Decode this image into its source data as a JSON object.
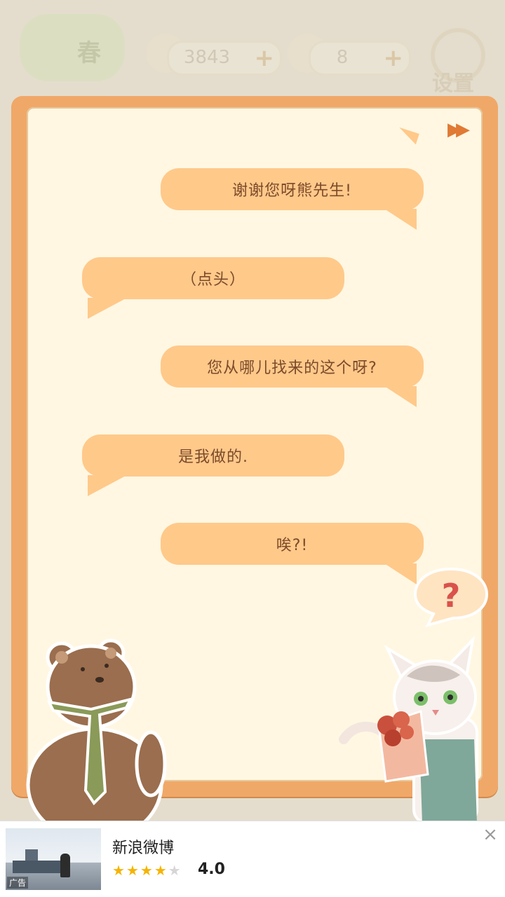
{
  "hud": {
    "logo_label": "春",
    "fish_count": "3843",
    "cheese_count": "8",
    "plus_symbol": "+",
    "settings_label": "设置"
  },
  "dialog": {
    "skip_symbol": "▶▶",
    "messages": [
      {
        "speaker": "cat",
        "text": "谢谢您呀熊先生!"
      },
      {
        "speaker": "bear",
        "text": "（点头）"
      },
      {
        "speaker": "cat",
        "text": "您从哪儿找来的这个呀?"
      },
      {
        "speaker": "bear",
        "text": "是我做的."
      },
      {
        "speaker": "cat",
        "text": "唉?!"
      }
    ],
    "cat_emote": "?"
  },
  "ad": {
    "tag": "广告",
    "title": "新浪微博",
    "rating": "4.0",
    "stars_filled": 4,
    "stars_total": 5,
    "close_symbol": "×"
  },
  "colors": {
    "frame": "#f0a868",
    "panel": "#fff7e2",
    "bubble": "#ffc98a",
    "bubble_text": "#7c4a2a",
    "star": "#f5b400"
  }
}
